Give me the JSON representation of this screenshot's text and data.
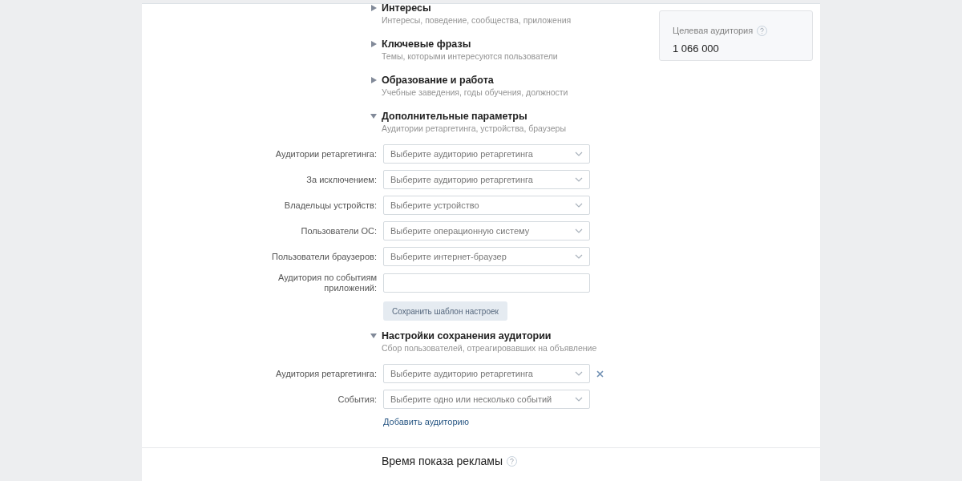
{
  "sections": [
    {
      "title": "Интересы",
      "subtitle": "Интересы, поведение, сообщества, приложения",
      "expanded": false
    },
    {
      "title": "Ключевые фразы",
      "subtitle": "Темы, которыми интересуются пользователи",
      "expanded": false
    },
    {
      "title": "Образование и работа",
      "subtitle": "Учебные заведения, годы обучения, должности",
      "expanded": false
    },
    {
      "title": "Дополнительные параметры",
      "subtitle": "Аудитории ретаргетинга, устройства, браузеры",
      "expanded": true,
      "fields": [
        {
          "kind": "select",
          "label": "Аудитории ретаргетинга:",
          "placeholder": "Выберите аудиторию ретаргетинга"
        },
        {
          "kind": "select",
          "label": "За исключением:",
          "placeholder": "Выберите аудиторию ретаргетинга"
        },
        {
          "kind": "select",
          "label": "Владельцы устройств:",
          "placeholder": "Выберите устройство"
        },
        {
          "kind": "select",
          "label": "Пользователи ОС:",
          "placeholder": "Выберите операционную систему"
        },
        {
          "kind": "select",
          "label": "Пользователи браузеров:",
          "placeholder": "Выберите интернет-браузер"
        },
        {
          "kind": "input",
          "label": "Аудитория по событиям приложений:"
        }
      ],
      "button": "Сохранить шаблон настроек"
    },
    {
      "title": "Настройки сохранения аудитории",
      "subtitle": "Сбор пользователей, отреагировавших на объявление",
      "expanded": true,
      "fields": [
        {
          "kind": "select",
          "label": "Аудитория ретаргетинга:",
          "placeholder": "Выберите аудиторию ретаргетинга",
          "removable": true
        },
        {
          "kind": "select",
          "label": "События:",
          "placeholder": "Выберите одно или несколько событий"
        }
      ],
      "link": "Добавить аудиторию"
    }
  ],
  "audience_card": {
    "label": "Целевая аудитория",
    "value": "1 066 000"
  },
  "next_section": {
    "title": "Время показа рекламы"
  }
}
